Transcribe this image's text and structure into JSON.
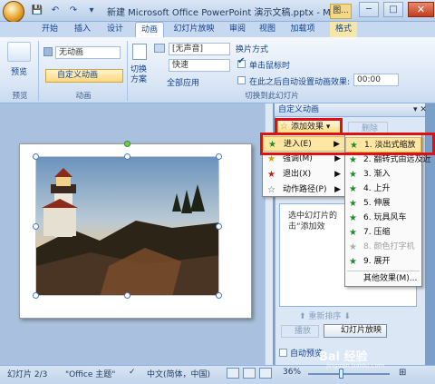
{
  "window": {
    "title": "新建 Microsoft Office PowerPoint 演示文稿.pptx - Mi...",
    "picture_tools": "图...",
    "minimize": "─",
    "maximize": "□",
    "close": "✕"
  },
  "quick_access": {
    "save": "💾",
    "undo": "↶",
    "redo": "↷",
    "more": "▾"
  },
  "tabs": [
    "开始",
    "插入",
    "设计",
    "动画",
    "幻灯片放映",
    "审阅",
    "视图",
    "加载项",
    "格式"
  ],
  "active_tab": "动画",
  "ribbon": {
    "preview_label": "预览",
    "preview_group": "预览",
    "anim_combo": "无动画",
    "custom_anim": "自定义动画",
    "anim_group": "动画",
    "switch_scheme": "切换\n方案",
    "sound": "[无声音]",
    "speed": "快速",
    "apply_all": "全部应用",
    "switch_method": "换片方式",
    "on_click": "单击鼠标时",
    "after_time": "在此之后自动设置动画效果:",
    "time_value": "00:00",
    "switch_group": "切换到此幻灯片"
  },
  "taskpane": {
    "title": "自定义动画",
    "close": "▾ ✕",
    "add_effect": "添加效果 ▾",
    "remove": "删除",
    "hint_line1": "选中幻灯片的",
    "hint_line2": "击“添加效",
    "reorder": "重新排序",
    "play": "播放",
    "slideshow": "幻灯片放映",
    "autopreview": "自动预览"
  },
  "menu": {
    "items": [
      {
        "label": "进入(E)",
        "icon": "enter-star-icon"
      },
      {
        "label": "强调(M)",
        "icon": "emphasis-star-icon"
      },
      {
        "label": "退出(X)",
        "icon": "exit-star-icon"
      },
      {
        "label": "动作路径(P)",
        "icon": "motion-path-icon"
      }
    ],
    "submenu": [
      {
        "label": "1. 淡出式缩放",
        "disabled": false
      },
      {
        "label": "2. 翻转式由远及近",
        "disabled": false
      },
      {
        "label": "3. 渐入",
        "disabled": false
      },
      {
        "label": "4. 上升",
        "disabled": false
      },
      {
        "label": "5. 伸展",
        "disabled": false
      },
      {
        "label": "6. 玩具风车",
        "disabled": false
      },
      {
        "label": "7. 压缩",
        "disabled": false
      },
      {
        "label": "8. 颜色打字机",
        "disabled": true
      },
      {
        "label": "9. 展开",
        "disabled": false
      },
      {
        "label": "其他效果(M)...",
        "disabled": false
      }
    ]
  },
  "status": {
    "slide": "幻灯片 2/3",
    "theme": "\"Office 主题\"",
    "lang": "中文(简体，中国)",
    "zoom": "36%"
  },
  "watermark": {
    "brand": "Bai 经验",
    "url": "jingyan.baidu.com"
  },
  "colors": {
    "accent": "#15428b",
    "highlight_border": "#e01010"
  }
}
